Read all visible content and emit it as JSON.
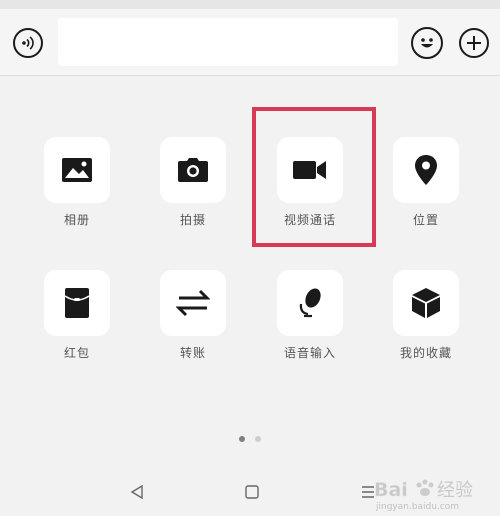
{
  "input": {
    "value": "",
    "placeholder": ""
  },
  "icons": {
    "voice": "voice-icon",
    "emoji": "emoji-icon",
    "plus": "plus-icon"
  },
  "panel": {
    "items": [
      {
        "label": "相册",
        "icon": "photo-album-icon"
      },
      {
        "label": "拍摄",
        "icon": "camera-icon"
      },
      {
        "label": "视频通话",
        "icon": "video-call-icon"
      },
      {
        "label": "位置",
        "icon": "location-icon"
      },
      {
        "label": "红包",
        "icon": "red-packet-icon"
      },
      {
        "label": "转账",
        "icon": "transfer-icon"
      },
      {
        "label": "语音输入",
        "icon": "voice-input-icon"
      },
      {
        "label": "我的收藏",
        "icon": "favorites-icon"
      }
    ],
    "page_count": 2,
    "current_page": 1
  },
  "highlight_color": "#d63a55",
  "watermark": {
    "brand": "Bai",
    "brand2": "经验",
    "url": "jingyan.baidu.com"
  }
}
